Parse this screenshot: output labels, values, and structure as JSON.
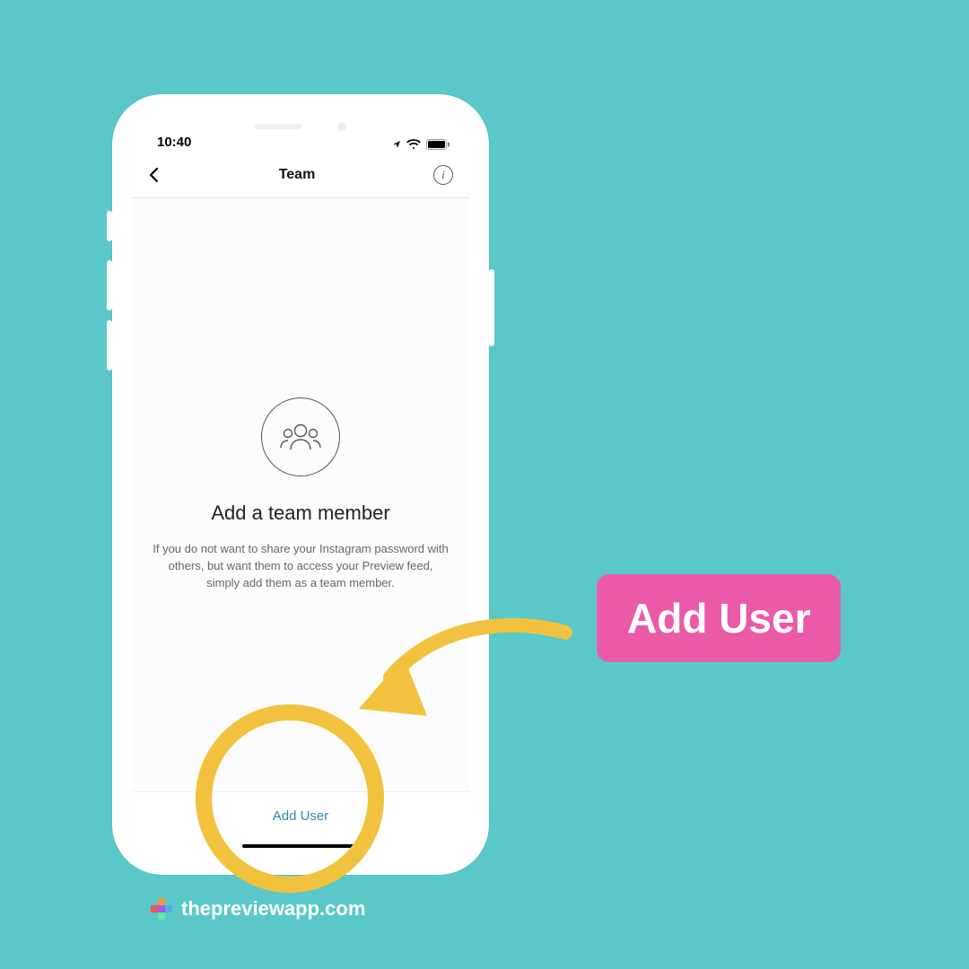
{
  "status": {
    "time": "10:40"
  },
  "nav": {
    "title": "Team"
  },
  "empty_state": {
    "heading": "Add a team member",
    "body": "If you do not want to share your Instagram password with others, but want them to access your Preview feed, simply add them as a team member."
  },
  "actions": {
    "add_user": "Add User"
  },
  "annotation": {
    "label": "Add User"
  },
  "footer": {
    "site": "thepreviewapp.com"
  }
}
